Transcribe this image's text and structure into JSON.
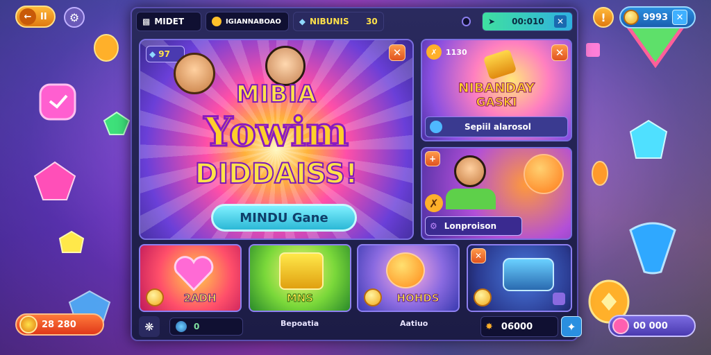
{
  "top_left": {
    "back_label": "II"
  },
  "top_right": {
    "coins": "9993"
  },
  "topbar": {
    "player": "MIDET",
    "currency_label": "IGIANNABOAO",
    "gems_label": "NIBUNIS",
    "gems_value": "30",
    "energy_value": "00:010"
  },
  "hero": {
    "badge_value": "97",
    "line1": "MIBIA",
    "line2": "Yowim",
    "line3": "DIDDAISS!",
    "button": "MINDU Gane"
  },
  "side1": {
    "timer": "1130",
    "title_line1": "NIBANDAY",
    "title_line2": "GASKI",
    "bar_label": "Sepiil alarosol"
  },
  "side2": {
    "bar_label": "Lonproison"
  },
  "cards": [
    {
      "label": "2ADH"
    },
    {
      "label": "MNS"
    },
    {
      "label": "HOHDS"
    },
    {
      "label": ""
    }
  ],
  "captions": [
    "Bepoatia",
    "Aatiuo"
  ],
  "bottombar": {
    "globe_value": "0",
    "score_value": "06000"
  },
  "bottom_left": {
    "value": "28 280"
  },
  "bottom_right": {
    "value": "00 000"
  },
  "colors": {
    "accent": "#7b6fe0",
    "gold": "#ffcf2a",
    "frame": "#1c1c45"
  }
}
